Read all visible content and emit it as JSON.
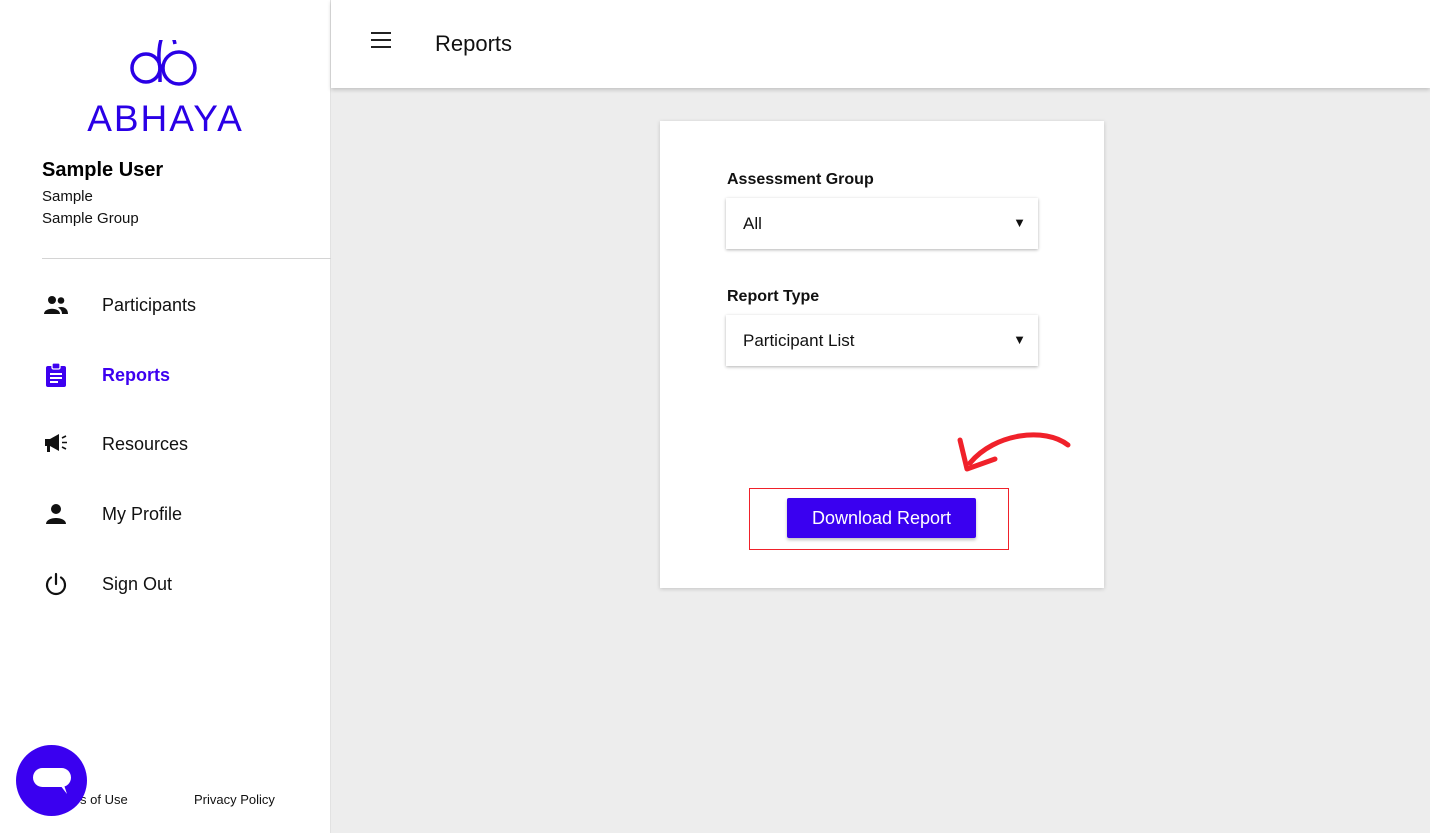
{
  "brand": {
    "name": "ABHAYA",
    "accent": "#3a00f0"
  },
  "user": {
    "name": "Sample User",
    "line1": "Sample",
    "line2": "Sample Group"
  },
  "nav": {
    "items": [
      {
        "label": "Participants",
        "icon": "people-icon"
      },
      {
        "label": "Reports",
        "icon": "clipboard-icon",
        "active": true
      },
      {
        "label": "Resources",
        "icon": "megaphone-icon"
      },
      {
        "label": "My Profile",
        "icon": "person-icon"
      },
      {
        "label": "Sign Out",
        "icon": "power-icon"
      }
    ]
  },
  "footer": {
    "terms": "s of Use",
    "privacy": "Privacy Policy"
  },
  "header": {
    "title": "Reports"
  },
  "form": {
    "assessment_group": {
      "label": "Assessment Group",
      "value": "All"
    },
    "report_type": {
      "label": "Report Type",
      "value": "Participant List"
    },
    "download_label": "Download Report"
  },
  "annotation": {
    "highlight_color": "#f0212a"
  }
}
